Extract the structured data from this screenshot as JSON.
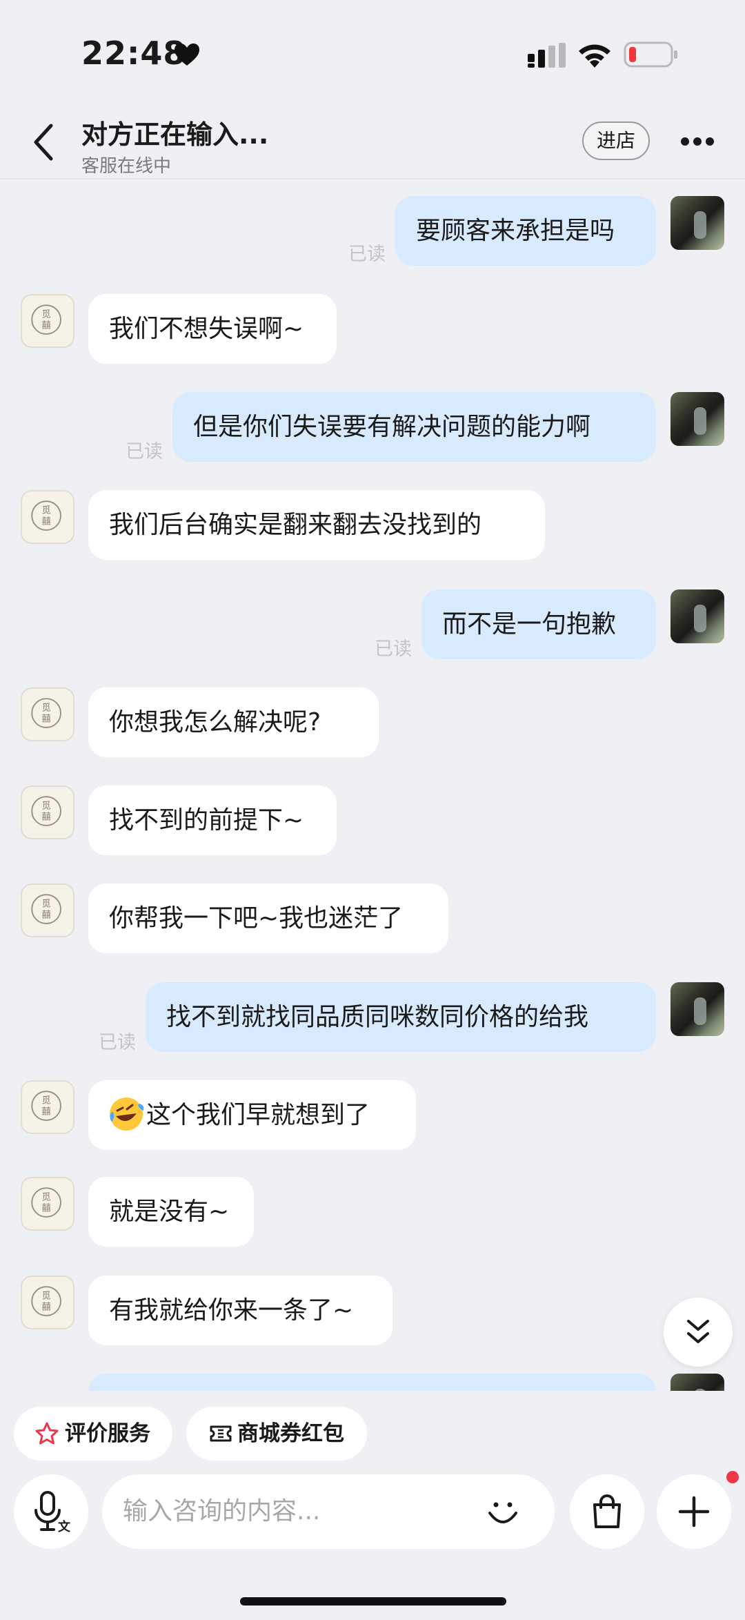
{
  "status_bar": {
    "time": "22:48"
  },
  "header": {
    "title": "对方正在输入...",
    "subtitle": "客服在线中",
    "enter_store": "进店"
  },
  "messages": [
    {
      "text": "要顾客来承担是吗",
      "read": "已读"
    },
    {
      "text": "我们不想失误啊~"
    },
    {
      "text": "但是你们失误要有解决问题的能力啊",
      "read": "已读"
    },
    {
      "text": "我们后台确实是翻来翻去没找到的"
    },
    {
      "text": "而不是一句抱歉",
      "read": "已读"
    },
    {
      "text": "你想我怎么解决呢?"
    },
    {
      "text": "找不到的前提下~"
    },
    {
      "text": "你帮我一下吧~我也迷茫了"
    },
    {
      "text": "找不到就找同品质同咪数同价格的给我",
      "read": "已读"
    },
    {
      "text": "这个我们早就想到了"
    },
    {
      "text": "就是没有~"
    },
    {
      "text": "有我就给你来一条了~"
    }
  ],
  "quick_actions": [
    {
      "label": "评价服务"
    },
    {
      "label": "商城券红包"
    }
  ],
  "input": {
    "placeholder": "输入咨询的内容..."
  },
  "colors": {
    "outgoing_bubble": "#d8ebfe",
    "incoming_bubble": "#ffffff",
    "background": "#eff0f3",
    "notification_dot": "#f2364a"
  },
  "icons": [
    "heart-icon",
    "signal-icon",
    "wifi-icon",
    "battery-icon",
    "back-icon",
    "more-icon",
    "shop-avatar",
    "user-avatar",
    "laughing-crying-emoji",
    "scroll-down-icon",
    "star-icon",
    "coupon-icon",
    "voice-input-icon",
    "smiley-icon",
    "shopping-bag-icon",
    "plus-icon"
  ]
}
